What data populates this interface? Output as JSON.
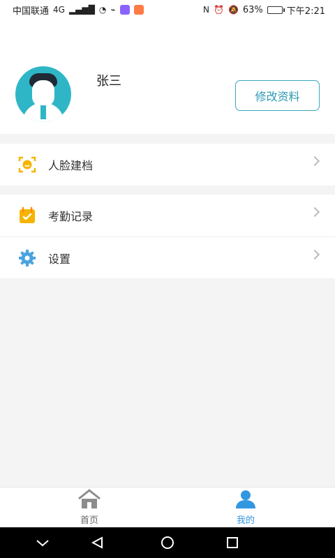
{
  "status_bar": {
    "carrier": "中国联通",
    "network": "4G",
    "battery_percent": "63%",
    "time": "下午2:21",
    "battery_level": 0.63
  },
  "profile": {
    "name": "张三",
    "edit_button": "修改资料"
  },
  "menu": {
    "face_record": "人脸建档",
    "attendance": "考勤记录",
    "settings": "设置"
  },
  "bottom_nav": {
    "home": "首页",
    "mine": "我的"
  },
  "colors": {
    "accent": "#3396e0",
    "button_border": "#3aa8c0",
    "icon_yellow": "#f5b400",
    "settings_blue": "#4aa3df"
  },
  "icons": {
    "face": "face-scan-icon",
    "attendance": "calendar-check-icon",
    "settings": "gear-icon",
    "home": "home-icon",
    "mine": "user-icon"
  }
}
